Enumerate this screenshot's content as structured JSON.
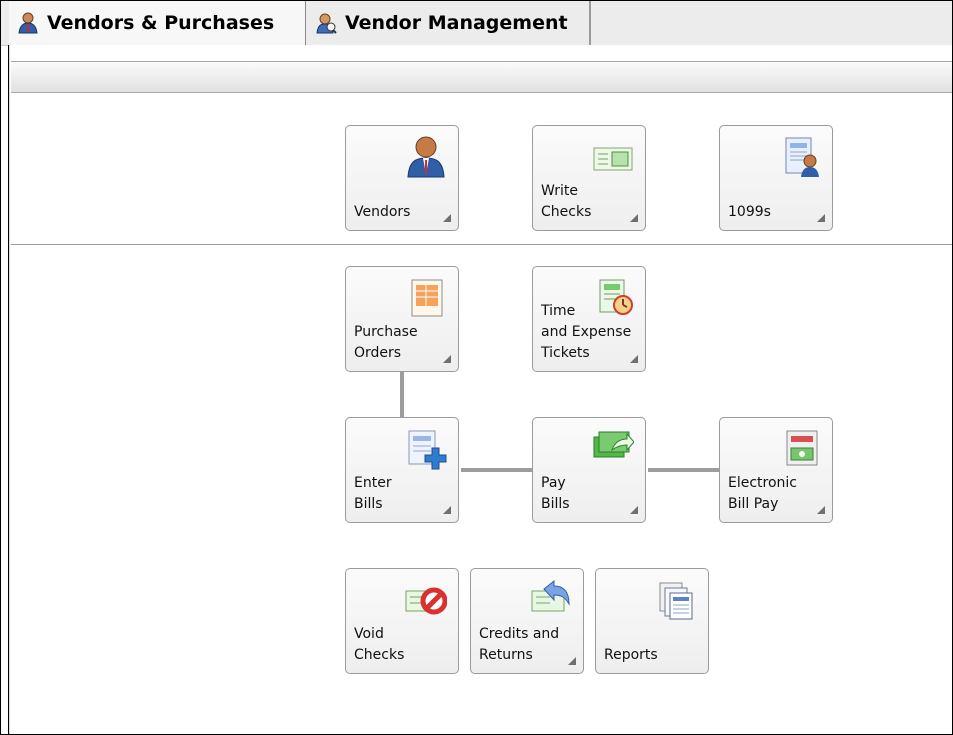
{
  "tabs": {
    "active": "Vendors & Purchases",
    "inactive": "Vendor Management"
  },
  "tiles": {
    "vendors": "Vendors",
    "write_checks": "Write\nChecks",
    "form_1099s": "1099s",
    "purchase_orders": "Purchase\nOrders",
    "time_expense": "Time\nand Expense\nTickets",
    "enter_bills": "Enter\nBills",
    "pay_bills": "Pay\nBills",
    "electronic_bill_pay": "Electronic\nBill Pay",
    "void_checks": "Void\nChecks",
    "credits_returns": "Credits and\nReturns",
    "reports": "Reports"
  },
  "icons": {
    "vendors": "vendor-person-icon",
    "write_checks": "check-icon",
    "form_1099s": "form-1099-icon",
    "purchase_orders": "purchase-order-icon",
    "time_expense": "time-expense-clock-icon",
    "enter_bills": "enter-bill-plus-icon",
    "pay_bills": "pay-bills-money-arrow-icon",
    "electronic_bill_pay": "electronic-bill-pay-icon",
    "void_checks": "void-check-icon",
    "credits_returns": "credits-returns-arrow-icon",
    "reports": "reports-icon"
  },
  "colors": {
    "tile_border": "#9b9b9b",
    "connector": "#9d9d9d",
    "void_red": "#d93030",
    "money_green": "#36a136",
    "person_blue": "#2f5fa7"
  }
}
